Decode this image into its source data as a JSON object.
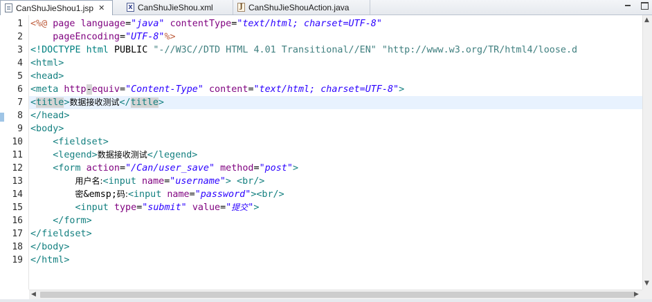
{
  "tabs": [
    {
      "label": "CanShuJieShou1.jsp",
      "icon": "jsp-file-icon",
      "active": true,
      "close": "✕"
    },
    {
      "label": "CanShuJieShou.xml",
      "icon": "xml-file-icon",
      "glyph": "X",
      "active": false
    },
    {
      "label": "CanShuJieShouAction.java",
      "icon": "java-file-icon",
      "glyph": "J",
      "active": false
    }
  ],
  "window_controls": [
    "minimize-icon",
    "maximize-icon"
  ],
  "editor": {
    "current_line": 7,
    "lines": [
      {
        "n": "1",
        "tokens": [
          [
            "dir",
            "<%@"
          ],
          [
            "text",
            " "
          ],
          [
            "attr",
            "page"
          ],
          [
            "text",
            " "
          ],
          [
            "attr",
            "language"
          ],
          [
            "text",
            "="
          ],
          [
            "str",
            "\"java\""
          ],
          [
            "text",
            " "
          ],
          [
            "attr",
            "contentType"
          ],
          [
            "text",
            "="
          ],
          [
            "str",
            "\"text/html; charset=UTF-8\""
          ]
        ]
      },
      {
        "n": "2",
        "tokens": [
          [
            "text",
            "    "
          ],
          [
            "attr",
            "pageEncoding"
          ],
          [
            "text",
            "="
          ],
          [
            "str",
            "\"UTF-8\""
          ],
          [
            "dir",
            "%>"
          ]
        ]
      },
      {
        "n": "3",
        "tokens": [
          [
            "doctype",
            "<!DOCTYPE html "
          ],
          [
            "text",
            "PUBLIC"
          ],
          [
            "text",
            " "
          ],
          [
            "dtstr",
            "\"-//W3C//DTD HTML 4.01 Transitional//EN\""
          ],
          [
            "text",
            " "
          ],
          [
            "dtstr",
            "\"http://www.w3.org/TR/html4/loose.d"
          ]
        ]
      },
      {
        "n": "4",
        "tokens": [
          [
            "tag",
            "<html>"
          ]
        ]
      },
      {
        "n": "5",
        "tokens": [
          [
            "tag",
            "<head>"
          ]
        ]
      },
      {
        "n": "6",
        "tokens": [
          [
            "tag",
            "<meta"
          ],
          [
            "text",
            " "
          ],
          [
            "attr",
            "http"
          ],
          [
            "hl",
            "-"
          ],
          [
            "attr",
            "equiv"
          ],
          [
            "text",
            "="
          ],
          [
            "str",
            "\"Content-Type\""
          ],
          [
            "text",
            " "
          ],
          [
            "attr",
            "content"
          ],
          [
            "text",
            "="
          ],
          [
            "str",
            "\"text/html; charset=UTF-8\""
          ],
          [
            "tag",
            ">"
          ]
        ]
      },
      {
        "n": "7",
        "tokens": [
          [
            "tag",
            "<"
          ],
          [
            "tag-hl",
            "title"
          ],
          [
            "tag",
            ">"
          ],
          [
            "cjk",
            "数据接收测试"
          ],
          [
            "tag",
            "</"
          ],
          [
            "tag-hl",
            "title"
          ],
          [
            "tag",
            ">"
          ]
        ]
      },
      {
        "n": "8",
        "tokens": [
          [
            "tag",
            "</head>"
          ]
        ]
      },
      {
        "n": "9",
        "tokens": [
          [
            "tag",
            "<body>"
          ]
        ]
      },
      {
        "n": "10",
        "tokens": [
          [
            "text",
            "    "
          ],
          [
            "tag",
            "<fieldset>"
          ]
        ]
      },
      {
        "n": "11",
        "tokens": [
          [
            "text",
            "    "
          ],
          [
            "tag",
            "<legend>"
          ],
          [
            "cjk",
            "数据接收测试"
          ],
          [
            "tag",
            "</legend>"
          ]
        ]
      },
      {
        "n": "12",
        "tokens": [
          [
            "text",
            "    "
          ],
          [
            "tag",
            "<form"
          ],
          [
            "text",
            " "
          ],
          [
            "attr",
            "action"
          ],
          [
            "text",
            "="
          ],
          [
            "str",
            "\"/Can/user_save\""
          ],
          [
            "text",
            " "
          ],
          [
            "attr",
            "method"
          ],
          [
            "text",
            "="
          ],
          [
            "str",
            "\"post\""
          ],
          [
            "tag",
            ">"
          ]
        ]
      },
      {
        "n": "13",
        "tokens": [
          [
            "text",
            "        "
          ],
          [
            "cjk",
            "用户名:"
          ],
          [
            "tag",
            "<input"
          ],
          [
            "text",
            " "
          ],
          [
            "attr",
            "name"
          ],
          [
            "text",
            "="
          ],
          [
            "str",
            "\"username\""
          ],
          [
            "tag",
            ">"
          ],
          [
            "text",
            " "
          ],
          [
            "tag",
            "<br/>"
          ]
        ]
      },
      {
        "n": "14",
        "tokens": [
          [
            "text",
            "        "
          ],
          [
            "cjk",
            "密"
          ],
          [
            "text",
            "&emsp;"
          ],
          [
            "cjk",
            "码:"
          ],
          [
            "tag",
            "<input"
          ],
          [
            "text",
            " "
          ],
          [
            "attr",
            "name"
          ],
          [
            "text",
            "="
          ],
          [
            "str",
            "\"password\""
          ],
          [
            "tag",
            ">"
          ],
          [
            "tag",
            "<br/>"
          ]
        ]
      },
      {
        "n": "15",
        "tokens": [
          [
            "text",
            "        "
          ],
          [
            "tag",
            "<input"
          ],
          [
            "text",
            " "
          ],
          [
            "attr",
            "type"
          ],
          [
            "text",
            "="
          ],
          [
            "str",
            "\"submit\""
          ],
          [
            "text",
            " "
          ],
          [
            "attr",
            "value"
          ],
          [
            "text",
            "="
          ],
          [
            "str",
            "\""
          ],
          [
            "cjk-str",
            "提交"
          ],
          [
            "str",
            "\""
          ],
          [
            "tag",
            ">"
          ]
        ]
      },
      {
        "n": "16",
        "tokens": [
          [
            "text",
            "    "
          ],
          [
            "tag",
            "</form>"
          ]
        ]
      },
      {
        "n": "17",
        "tokens": [
          [
            "tag",
            "</fieldset>"
          ]
        ]
      },
      {
        "n": "18",
        "tokens": [
          [
            "tag",
            "</body>"
          ]
        ]
      },
      {
        "n": "19",
        "tokens": [
          [
            "tag",
            "</html>"
          ]
        ]
      }
    ]
  },
  "scrollbar": {
    "left_arrow": "◀",
    "right_arrow": "▶",
    "up_arrow": "▲",
    "down_arrow": "▼"
  },
  "colors": {
    "tag": "#127f7f",
    "attribute": "#7f007f",
    "string": "#2a00ff",
    "directive": "#bf5f3f",
    "current_line": "#e8f2fe"
  }
}
